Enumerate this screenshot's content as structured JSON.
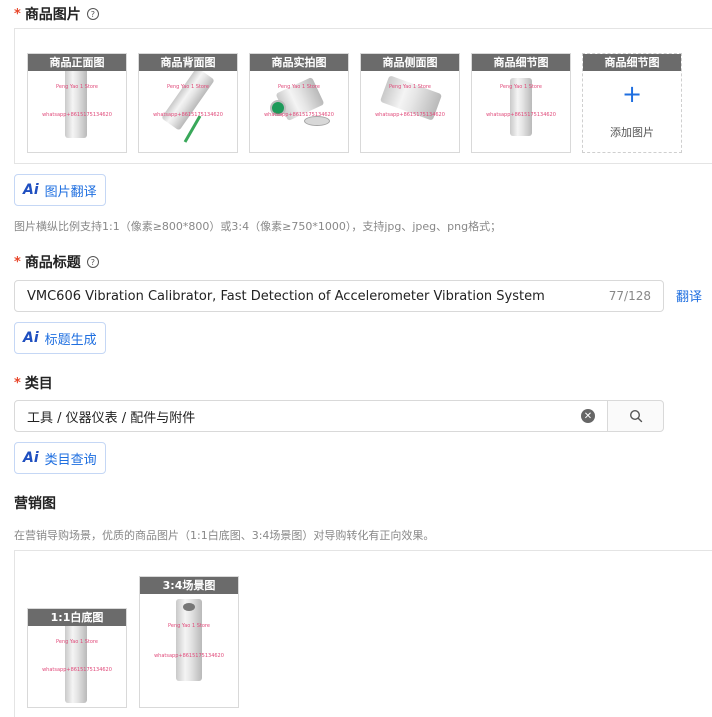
{
  "images_section": {
    "label": "商品图片",
    "required_mark": "*",
    "help_icon": "question-circle-icon",
    "thumbnails": [
      {
        "tag": "商品正面图",
        "watermark_1": "Peng Yao 1 Store",
        "watermark_2": "whatsapp+8615175134620"
      },
      {
        "tag": "商品背面图",
        "watermark_1": "Peng Yao 1 Store",
        "watermark_2": "whatsapp+8615175134620"
      },
      {
        "tag": "商品实拍图",
        "watermark_1": "Peng Yao 1 Store",
        "watermark_2": "whatsapp+8615175134620"
      },
      {
        "tag": "商品侧面图",
        "watermark_1": "Peng Yao 1 Store",
        "watermark_2": "whatsapp+8615175134620"
      },
      {
        "tag": "商品细节图",
        "watermark_1": "Peng Yao 1 Store",
        "watermark_2": "whatsapp+8615175134620"
      }
    ],
    "add_box": {
      "tag": "商品细节图",
      "plus": "+",
      "label": "添加图片"
    },
    "ai_button": {
      "ai": "Ai",
      "label": "图片翻译"
    },
    "hint": "图片横纵比例支持1:1（像素≥800*800）或3:4（像素≥750*1000），支持jpg、jpeg、png格式；"
  },
  "title_section": {
    "label": "商品标题",
    "required_mark": "*",
    "help_icon": "question-circle-icon",
    "value": "VMC606 Vibration Calibrator, Fast Detection of Accelerometer Vibration System",
    "counter": "77/128",
    "translate_link": "翻译",
    "ai_button": {
      "ai": "Ai",
      "label": "标题生成"
    }
  },
  "category_section": {
    "label": "类目",
    "required_mark": "*",
    "value": "工具 / 仪器仪表 / 配件与附件",
    "clear_icon": "clear-circle-icon",
    "search_icon": "search-icon",
    "ai_button": {
      "ai": "Ai",
      "label": "类目查询"
    }
  },
  "marketing_section": {
    "label": "营销图",
    "hint": "在营销导购场景，优质的商品图片（1:1白底图、3:4场景图）对导购转化有正向效果。",
    "thumbnails": [
      {
        "tag": "1:1白底图",
        "watermark_1": "Peng Yao 1 Store",
        "watermark_2": "whatsapp+8615175134620"
      },
      {
        "tag": "3:4场景图",
        "watermark_1": "Peng Yao 1 Store",
        "watermark_2": "whatsapp+8615175134620"
      }
    ]
  }
}
